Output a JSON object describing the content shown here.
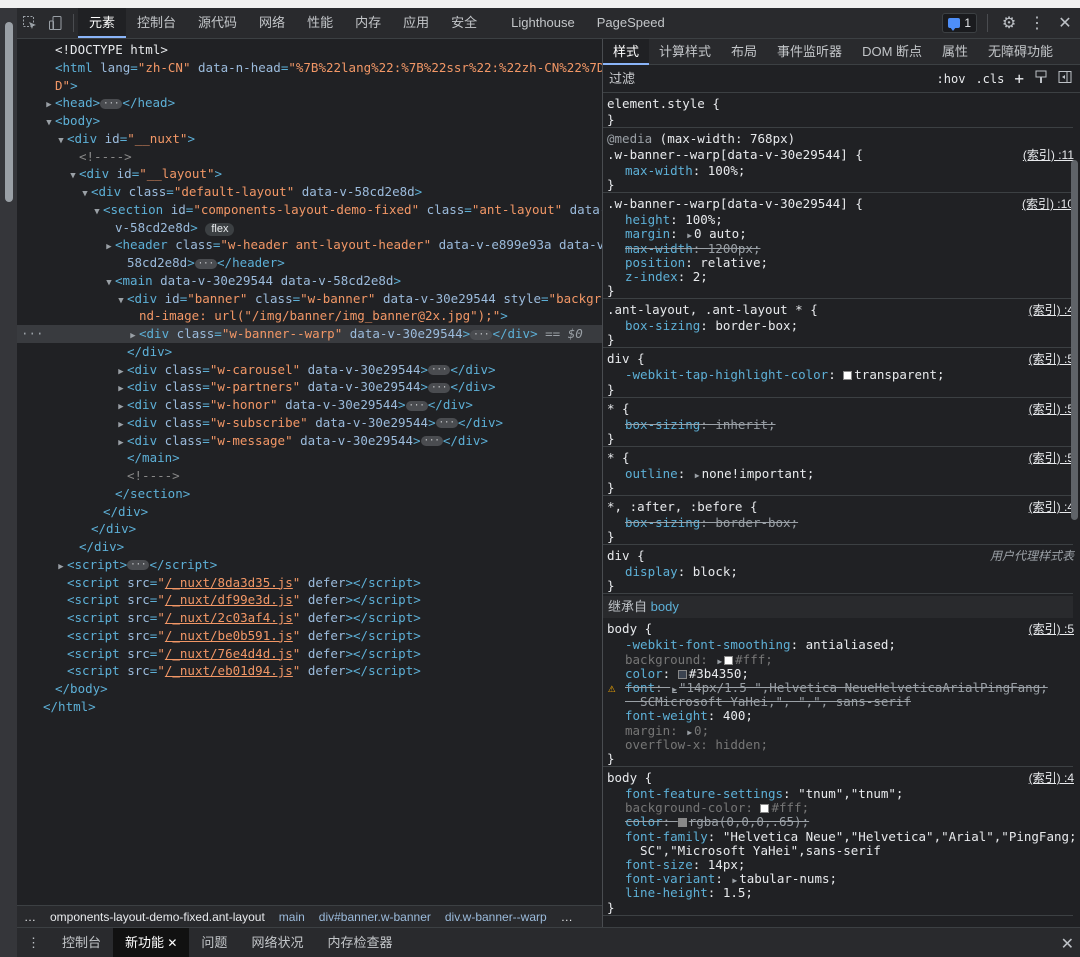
{
  "toolbar": {
    "tabs": [
      "元素",
      "控制台",
      "源代码",
      "网络",
      "性能",
      "内存",
      "应用",
      "安全",
      "Lighthouse",
      "PageSpeed"
    ],
    "active_tab": "元素",
    "issues_count": "1",
    "icons": [
      "inspect-icon",
      "device-icon",
      "chat-icon",
      "gear-icon",
      "kebab-icon",
      "close-icon"
    ]
  },
  "dom": {
    "lines": [
      {
        "i": 0,
        "tw": "",
        "h": "<span class='tx'>&lt;!DOCTYPE html&gt;</span>"
      },
      {
        "i": 0,
        "tw": "",
        "h": "<span class='t'>&lt;html </span><span class='an'>lang</span><span class='t'>=</span><span class='av'>\"zh-CN\"</span> <span class='an'>data-n-head</span><span class='t'>=</span><span class='av'>\"%7B%22lang%22:%7B%22ssr%22:%22zh-CN%22%7D%7</span>"
      },
      {
        "i": 0,
        "tw": "",
        "h": "<span class='av'>D\"</span><span class='t'>&gt;</span>"
      },
      {
        "i": 0,
        "tw": "▶",
        "h": "<span class='t'>&lt;head&gt;</span><span class='ell'>···</span><span class='t'>&lt;/head&gt;</span>"
      },
      {
        "i": 0,
        "tw": "▼",
        "h": "<span class='t'>&lt;body&gt;</span>"
      },
      {
        "i": 1,
        "tw": "▼",
        "h": "<span class='t'>&lt;div </span><span class='an'>id</span><span class='t'>=</span><span class='av'>\"__nuxt\"</span><span class='t'>&gt;</span>"
      },
      {
        "i": 2,
        "tw": "",
        "h": "<span class='cm'>&lt;!----&gt;</span>"
      },
      {
        "i": 2,
        "tw": "▼",
        "h": "<span class='t'>&lt;div </span><span class='an'>id</span><span class='t'>=</span><span class='av'>\"__layout\"</span><span class='t'>&gt;</span>"
      },
      {
        "i": 3,
        "tw": "▼",
        "h": "<span class='t'>&lt;div </span><span class='an'>class</span><span class='t'>=</span><span class='av'>\"default-layout\"</span> <span class='an'>data-v-58cd2e8d</span><span class='t'>&gt;</span>"
      },
      {
        "i": 4,
        "tw": "▼",
        "h": "<span class='t'>&lt;section </span><span class='an'>id</span><span class='t'>=</span><span class='av'>\"components-layout-demo-fixed\"</span> <span class='an'>class</span><span class='t'>=</span><span class='av'>\"ant-layout\"</span> <span class='an'>data-</span>"
      },
      {
        "i": 5,
        "tw": "",
        "h": "<span class='an'>v-58cd2e8d</span><span class='t'>&gt;</span> <span class='flex'>flex</span>"
      },
      {
        "i": 5,
        "tw": "▶",
        "h": "<span class='t'>&lt;header </span><span class='an'>class</span><span class='t'>=</span><span class='av'>\"w-header ant-layout-header\"</span> <span class='an'>data-v-e899e93a data-v-</span>"
      },
      {
        "i": 6,
        "tw": "",
        "h": "<span class='an'>58cd2e8d</span><span class='t'>&gt;</span><span class='ell'>···</span><span class='t'>&lt;/header&gt;</span>"
      },
      {
        "i": 5,
        "tw": "▼",
        "h": "<span class='t'>&lt;main </span><span class='an'>data-v-30e29544 data-v-58cd2e8d</span><span class='t'>&gt;</span>"
      },
      {
        "i": 6,
        "tw": "▼",
        "h": "<span class='t'>&lt;div </span><span class='an'>id</span><span class='t'>=</span><span class='av'>\"banner\"</span> <span class='an'>class</span><span class='t'>=</span><span class='av'>\"w-banner\"</span> <span class='an'>data-v-30e29544</span> <span class='an'>style</span><span class='t'>=</span><span class='av'>\"backgrou</span>"
      },
      {
        "i": 7,
        "tw": "",
        "h": "<span class='av'>nd-image: url(\"/img/banner/img_banner@2x.jpg\");\"</span><span class='t'>&gt;</span>"
      },
      {
        "i": 7,
        "tw": "▶",
        "sel": true,
        "h": "<span class='t'>&lt;div </span><span class='an'>class</span><span class='t'>=</span><span class='av'>\"w-banner--warp\"</span> <span class='an'>data-v-30e29544</span><span class='t'>&gt;</span><span class='ell'>···</span><span class='t'>&lt;/div&gt;</span> <span class='eq'>== $0</span>"
      },
      {
        "i": 6,
        "tw": "",
        "h": "<span class='t'>&lt;/div&gt;</span>"
      },
      {
        "i": 6,
        "tw": "▶",
        "h": "<span class='t'>&lt;div </span><span class='an'>class</span><span class='t'>=</span><span class='av'>\"w-carousel\"</span> <span class='an'>data-v-30e29544</span><span class='t'>&gt;</span><span class='ell'>···</span><span class='t'>&lt;/div&gt;</span>"
      },
      {
        "i": 6,
        "tw": "▶",
        "h": "<span class='t'>&lt;div </span><span class='an'>class</span><span class='t'>=</span><span class='av'>\"w-partners\"</span> <span class='an'>data-v-30e29544</span><span class='t'>&gt;</span><span class='ell'>···</span><span class='t'>&lt;/div&gt;</span>"
      },
      {
        "i": 6,
        "tw": "▶",
        "h": "<span class='t'>&lt;div </span><span class='an'>class</span><span class='t'>=</span><span class='av'>\"w-honor\"</span> <span class='an'>data-v-30e29544</span><span class='t'>&gt;</span><span class='ell'>···</span><span class='t'>&lt;/div&gt;</span>"
      },
      {
        "i": 6,
        "tw": "▶",
        "h": "<span class='t'>&lt;div </span><span class='an'>class</span><span class='t'>=</span><span class='av'>\"w-subscribe\"</span> <span class='an'>data-v-30e29544</span><span class='t'>&gt;</span><span class='ell'>···</span><span class='t'>&lt;/div&gt;</span>"
      },
      {
        "i": 6,
        "tw": "▶",
        "h": "<span class='t'>&lt;div </span><span class='an'>class</span><span class='t'>=</span><span class='av'>\"w-message\"</span> <span class='an'>data-v-30e29544</span><span class='t'>&gt;</span><span class='ell'>···</span><span class='t'>&lt;/div&gt;</span>"
      },
      {
        "i": 6,
        "tw": "",
        "h": "<span class='t'>&lt;/main&gt;</span>"
      },
      {
        "i": 6,
        "tw": "",
        "h": "<span class='cm'>&lt;!----&gt;</span>"
      },
      {
        "i": 5,
        "tw": "",
        "h": "<span class='t'>&lt;/section&gt;</span>"
      },
      {
        "i": 4,
        "tw": "",
        "h": "<span class='t'>&lt;/div&gt;</span>"
      },
      {
        "i": 3,
        "tw": "",
        "h": "<span class='t'>&lt;/div&gt;</span>"
      },
      {
        "i": 2,
        "tw": "",
        "h": "<span class='t'>&lt;/div&gt;</span>"
      },
      {
        "i": 1,
        "tw": "▶",
        "h": "<span class='t'>&lt;script&gt;</span><span class='ell'>···</span><span class='t'>&lt;/script&gt;</span>"
      },
      {
        "i": 1,
        "tw": "",
        "h": "<span class='t'>&lt;script </span><span class='an'>src</span><span class='t'>=</span><span class='av'>\"</span><span class='lk'>/_nuxt/8da3d35.js</span><span class='av'>\"</span> <span class='an'>defer</span><span class='t'>&gt;&lt;/script&gt;</span>"
      },
      {
        "i": 1,
        "tw": "",
        "h": "<span class='t'>&lt;script </span><span class='an'>src</span><span class='t'>=</span><span class='av'>\"</span><span class='lk'>/_nuxt/df99e3d.js</span><span class='av'>\"</span> <span class='an'>defer</span><span class='t'>&gt;&lt;/script&gt;</span>"
      },
      {
        "i": 1,
        "tw": "",
        "h": "<span class='t'>&lt;script </span><span class='an'>src</span><span class='t'>=</span><span class='av'>\"</span><span class='lk'>/_nuxt/2c03af4.js</span><span class='av'>\"</span> <span class='an'>defer</span><span class='t'>&gt;&lt;/script&gt;</span>"
      },
      {
        "i": 1,
        "tw": "",
        "h": "<span class='t'>&lt;script </span><span class='an'>src</span><span class='t'>=</span><span class='av'>\"</span><span class='lk'>/_nuxt/be0b591.js</span><span class='av'>\"</span> <span class='an'>defer</span><span class='t'>&gt;&lt;/script&gt;</span>"
      },
      {
        "i": 1,
        "tw": "",
        "h": "<span class='t'>&lt;script </span><span class='an'>src</span><span class='t'>=</span><span class='av'>\"</span><span class='lk'>/_nuxt/76e4d4d.js</span><span class='av'>\"</span> <span class='an'>defer</span><span class='t'>&gt;&lt;/script&gt;</span>"
      },
      {
        "i": 1,
        "tw": "",
        "h": "<span class='t'>&lt;script </span><span class='an'>src</span><span class='t'>=</span><span class='av'>\"</span><span class='lk'>/_nuxt/eb01d94.js</span><span class='av'>\"</span> <span class='an'>defer</span><span class='t'>&gt;&lt;/script&gt;</span>"
      },
      {
        "i": 0,
        "tw": "",
        "h": "<span class='t'>&lt;/body&gt;</span>"
      },
      {
        "i": -1,
        "tw": "",
        "h": "<span class='t'>&lt;/html&gt;</span>"
      }
    ]
  },
  "breadcrumbs": [
    "omponents-layout-demo-fixed.ant-layout",
    "main",
    "div#banner.w-banner",
    "div.w-banner--warp"
  ],
  "styles": {
    "tabs": [
      "样式",
      "计算样式",
      "布局",
      "事件监听器",
      "DOM 断点",
      "属性",
      "无障碍功能"
    ],
    "filter_placeholder": "过滤",
    "tools": [
      ":hov",
      ".cls",
      "+"
    ],
    "inherited_label": "继承自",
    "inherited_from": "body",
    "rules": [
      {
        "sel": "element.style {",
        "src": "",
        "lines": []
      },
      {
        "media": "@media (max-width: 768px)",
        "sel": ".w-banner--warp[data-v-30e29544] {",
        "src": "(索引) :11",
        "lines": [
          [
            "max-width",
            "100%",
            ""
          ]
        ]
      },
      {
        "sel": ".w-banner--warp[data-v-30e29544] {",
        "src": "(索引) :10",
        "lines": [
          [
            "height",
            "100%",
            ""
          ],
          [
            "margin",
            "0 auto",
            ""
          ],
          [
            "max-width",
            "1200px",
            "strike"
          ],
          [
            "position",
            "relative",
            ""
          ],
          [
            "z-index",
            "2",
            ""
          ]
        ]
      },
      {
        "sel": ".ant-layout, .ant-layout * {",
        "src": "(索引) :4",
        "lines": [
          [
            "box-sizing",
            "border-box",
            ""
          ]
        ]
      },
      {
        "sel": "div {",
        "src": "(索引) :5",
        "lines": [
          [
            "-webkit-tap-highlight-color",
            "transparent",
            "swatch"
          ]
        ]
      },
      {
        "sel": "* {",
        "src": "(索引) :5",
        "lines": [
          [
            "box-sizing",
            "inherit",
            "strike"
          ]
        ]
      },
      {
        "sel": "* {",
        "src": "(索引) :5",
        "lines": [
          [
            "outline",
            "none!important",
            ""
          ]
        ]
      },
      {
        "sel": "*, :after, :before {",
        "src": "(索引) :4",
        "lines": [
          [
            "box-sizing",
            "border-box",
            "strike"
          ]
        ]
      },
      {
        "sel": "div {",
        "src": "用户代理样式表",
        "ua": true,
        "lines": [
          [
            "display",
            "block",
            ""
          ]
        ]
      }
    ],
    "body_rule1": {
      "sel": "body {",
      "src": "(索引) :5",
      "lines": [
        [
          "-webkit-font-smoothing",
          "antialiased",
          ""
        ],
        [
          "background",
          "#fff",
          "dim"
        ],
        [
          "color",
          "#3b4350",
          ""
        ],
        [
          "font",
          "\"14px/1.5 \",Helvetica NeueHelveticaArialPingFang",
          "strikewarn"
        ],
        [
          "",
          "SCMicrosoft YaHei,\", \",\", sans-serif",
          "strikecont"
        ],
        [
          "font-weight",
          "400",
          ""
        ],
        [
          "margin",
          "0",
          "dim"
        ],
        [
          "overflow-x",
          "hidden",
          "dim"
        ]
      ]
    },
    "body_rule2": {
      "sel": "body {",
      "src": "(索引) :4",
      "lines": [
        [
          "font-feature-settings",
          "\"tnum\",\"tnum\"",
          ""
        ],
        [
          "background-color",
          "#fff",
          "dim"
        ],
        [
          "color",
          "rgba(0,0,0,.65)",
          "strike"
        ],
        [
          "font-family",
          "\"Helvetica Neue\",\"Helvetica\",\"Arial\",\"PingFang",
          ""
        ],
        [
          "",
          "SC\",\"Microsoft YaHei\",sans-serif",
          "cont"
        ],
        [
          "font-size",
          "14px",
          ""
        ],
        [
          "font-variant",
          "tabular-nums",
          ""
        ],
        [
          "line-height",
          "1.5",
          ""
        ]
      ]
    }
  },
  "drawer": {
    "tabs": [
      "控制台",
      "新功能",
      "问题",
      "网络状况",
      "内存检查器"
    ],
    "active": "新功能"
  }
}
